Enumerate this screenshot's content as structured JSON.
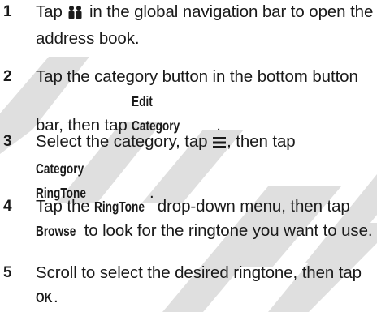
{
  "watermark": {
    "color": "#d6d6d6"
  },
  "steps": [
    {
      "num": "1",
      "pre": "Tap ",
      "icon": "address-book-people-icon",
      "post": " in the global navigation bar to open the address book."
    },
    {
      "num": "2",
      "pre": "Tap the category button in the bottom button bar, then tap ",
      "kw": "Edit Category",
      "post": "."
    },
    {
      "num": "3",
      "pre": "Select the category, tap ",
      "icon": "menu-lines-icon",
      "mid": ", then tap ",
      "kw": "Category RingTone",
      "post": "."
    },
    {
      "num": "4",
      "pre": "Tap the ",
      "kw1": "RingTone",
      "mid": " drop-down menu, then tap ",
      "kw2": "Browse",
      "post": " to look for the ringtone you want to use."
    },
    {
      "num": "5",
      "pre": "Scroll to select the desired ringtone, then tap ",
      "kw": "OK",
      "post": "."
    }
  ]
}
